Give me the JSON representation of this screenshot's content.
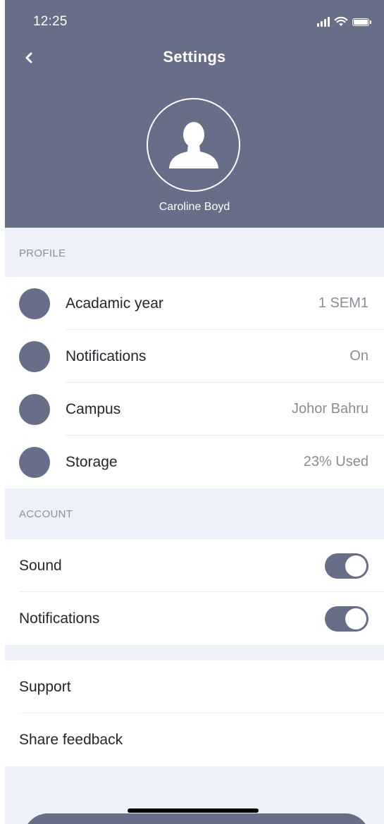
{
  "status_bar": {
    "time": "12:25",
    "icons": [
      "signal-icon",
      "wifi-icon",
      "battery-icon"
    ]
  },
  "header": {
    "title": "Settings",
    "back_icon": "chevron-left-icon",
    "avatar_icon": "user-silhouette-icon",
    "user_name": "Caroline Boyd"
  },
  "profile": {
    "section_label": "PROFILE",
    "items": [
      {
        "label": "Acadamic year",
        "value": "1 SEM1"
      },
      {
        "label": "Notifications",
        "value": "On"
      },
      {
        "label": "Campus",
        "value": "Johor Bahru"
      },
      {
        "label": "Storage",
        "value": "23% Used"
      }
    ]
  },
  "account": {
    "section_label": "ACCOUNT",
    "toggles": [
      {
        "label": "Sound",
        "on": true
      },
      {
        "label": "Notifications",
        "on": true
      }
    ]
  },
  "more": {
    "items": [
      {
        "label": "Support"
      },
      {
        "label": "Share feedback"
      }
    ]
  },
  "colors": {
    "primary": "#676e88",
    "section_background": "#eef1f9",
    "secondary_text": "#8a8d97"
  }
}
